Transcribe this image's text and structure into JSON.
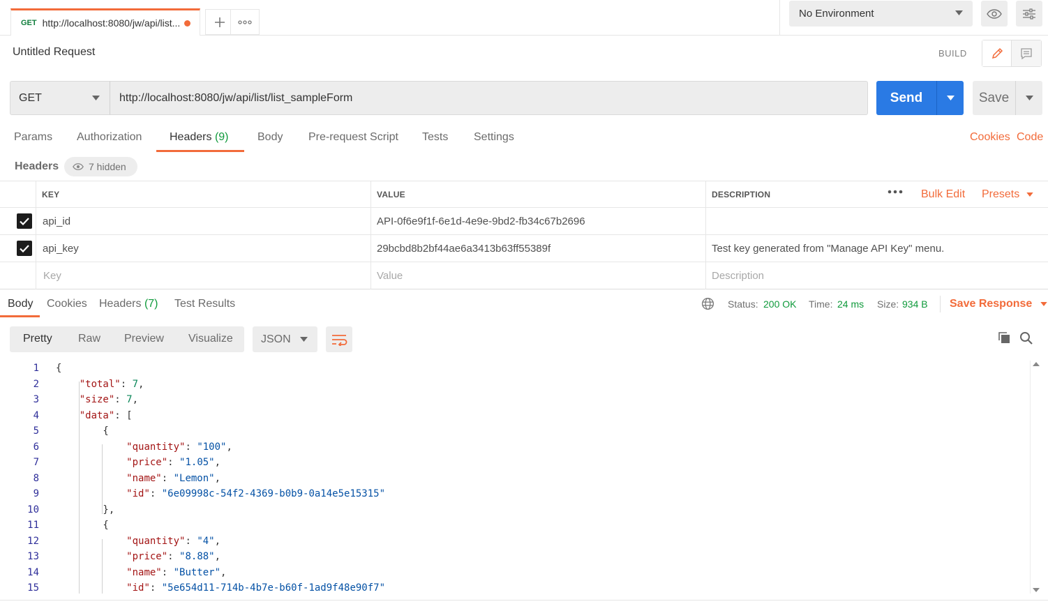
{
  "tab": {
    "method": "GET",
    "url": "http://localhost:8080/jw/api/list..."
  },
  "environment": {
    "selected": "No Environment"
  },
  "request": {
    "title": "Untitled Request",
    "build_label": "BUILD",
    "method": "GET",
    "url": "http://localhost:8080/jw/api/list/list_sampleForm",
    "send_label": "Send",
    "save_label": "Save"
  },
  "request_tabs": {
    "params": "Params",
    "authorization": "Authorization",
    "headers": "Headers",
    "headers_count": "(9)",
    "body": "Body",
    "prerequest": "Pre-request Script",
    "tests": "Tests",
    "settings": "Settings",
    "cookies": "Cookies",
    "code": "Code"
  },
  "headers_section": {
    "label": "Headers",
    "hidden": "7 hidden",
    "columns": {
      "key": "KEY",
      "value": "VALUE",
      "description": "DESCRIPTION"
    },
    "bulk_edit": "Bulk Edit",
    "presets": "Presets",
    "rows": [
      {
        "key": "api_id",
        "value": "API-0f6e9f1f-6e1d-4e9e-9bd2-fb34c67b2696",
        "description": ""
      },
      {
        "key": "api_key",
        "value": "29bcbd8b2bf44ae6a3413b63ff55389f",
        "description": "Test key generated from \"Manage API Key\" menu."
      }
    ],
    "placeholders": {
      "key": "Key",
      "value": "Value",
      "description": "Description"
    }
  },
  "response": {
    "tabs": {
      "body": "Body",
      "cookies": "Cookies",
      "headers": "Headers",
      "headers_count": "(7)",
      "tests": "Test Results"
    },
    "status_label": "Status:",
    "status_value": "200 OK",
    "time_label": "Time:",
    "time_value": "24 ms",
    "size_label": "Size:",
    "size_value": "934 B",
    "save_response": "Save Response",
    "formats": {
      "pretty": "Pretty",
      "raw": "Raw",
      "preview": "Preview",
      "visualize": "Visualize"
    },
    "language": "JSON"
  },
  "code_lines": [
    {
      "n": "1",
      "t": "{"
    },
    {
      "n": "2",
      "t": "    \"total\": 7,"
    },
    {
      "n": "3",
      "t": "    \"size\": 7,"
    },
    {
      "n": "4",
      "t": "    \"data\": ["
    },
    {
      "n": "5",
      "t": "        {"
    },
    {
      "n": "6",
      "t": "            \"quantity\": \"100\","
    },
    {
      "n": "7",
      "t": "            \"price\": \"1.05\","
    },
    {
      "n": "8",
      "t": "            \"name\": \"Lemon\","
    },
    {
      "n": "9",
      "t": "            \"id\": \"6e09998c-54f2-4369-b0b9-0a14e5e15315\""
    },
    {
      "n": "10",
      "t": "        },"
    },
    {
      "n": "11",
      "t": "        {"
    },
    {
      "n": "12",
      "t": "            \"quantity\": \"4\","
    },
    {
      "n": "13",
      "t": "            \"price\": \"8.88\","
    },
    {
      "n": "14",
      "t": "            \"name\": \"Butter\","
    },
    {
      "n": "15",
      "t": "            \"id\": \"5e654d11-714b-4b7e-b60f-1ad9f48e90f7\""
    }
  ]
}
